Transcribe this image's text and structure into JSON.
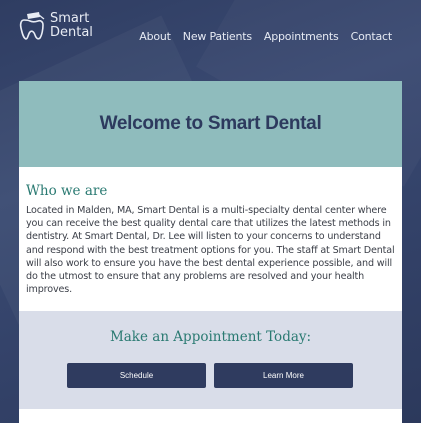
{
  "brand": {
    "line1": "Smart",
    "line2": "Dental",
    "icon": "tooth-with-cap-icon"
  },
  "nav": {
    "items": [
      "About",
      "New Patients",
      "Appointments",
      "Contact"
    ]
  },
  "hero": {
    "title": "Welcome to Smart Dental"
  },
  "about": {
    "heading": "Who we are",
    "body": "Located in Malden, MA, Smart Dental is a multi-specialty dental center where you can receive the best quality dental care that utilizes the latest methods in dentistry. At Smart Dental, Dr. Lee will listen to your concerns to understand and respond with the best treatment options for you. The staff at Smart Dental will also work to ensure you have the best dental experience possible, and will do the utmost to ensure that any problems are resolved and your health improves."
  },
  "appointment": {
    "heading": "Make an Appointment Today:",
    "schedule_label": "Schedule",
    "learn_more_label": "Learn More"
  },
  "colors": {
    "background": "#34436a",
    "hero": "#8fbcbd",
    "accent": "#2a7a72",
    "button": "#2f3b5f",
    "appointment_band": "#d9dde9"
  }
}
